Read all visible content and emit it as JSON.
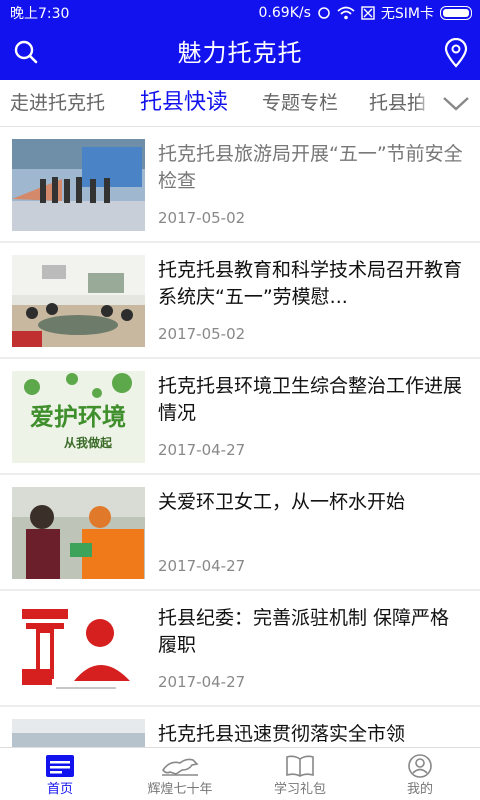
{
  "status": {
    "time": "晚上7:30",
    "speed": "0.69K/s",
    "sim": "无SIM卡"
  },
  "appbar": {
    "title": "魅力托克托"
  },
  "tabs": [
    {
      "label": "走进托克托"
    },
    {
      "label": "托县快读"
    },
    {
      "label": "专题专栏"
    },
    {
      "label": "托县拍"
    }
  ],
  "articles": [
    {
      "title": "托克托县旅游局开展“五一”节前安全检查",
      "date": "2017-05-02"
    },
    {
      "title": "托克托县教育和科学技术局召开教育系统庆“五一”劳模慰...",
      "date": "2017-05-02"
    },
    {
      "title": "托克托县环境卫生综合整治工作进展情况",
      "date": "2017-04-27",
      "image_text": "爱护环境",
      "image_subtext": "从我做起"
    },
    {
      "title": "关爱环卫女工，从一杯水开始",
      "date": "2017-04-27"
    },
    {
      "title": "托县纪委：完善派驻机制 保障严格履职",
      "date": "2017-04-27"
    },
    {
      "title": "托克托县迅速贯彻落实全市领",
      "date": ""
    }
  ],
  "nav": [
    {
      "label": "首页"
    },
    {
      "label": "辉煌七十年"
    },
    {
      "label": "学习礼包"
    },
    {
      "label": "我的"
    }
  ],
  "colors": {
    "primary": "#1212ee",
    "inactive": "#777777"
  }
}
